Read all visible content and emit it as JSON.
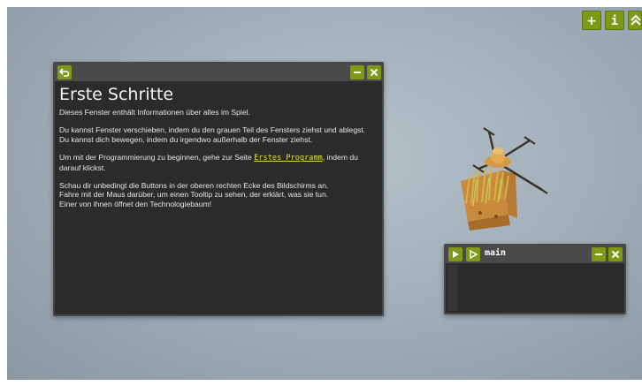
{
  "toolbar": {
    "add_label": "+",
    "info_label": "i",
    "collapse_label": "≫"
  },
  "info_window": {
    "title": "Erste Schritte",
    "intro": "Dieses Fenster enthält Informationen über alles im Spiel.",
    "move_text_1": "Du kannst Fenster verschieben, indem du den grauen Teil des Fensters ziehst und ablegst.",
    "move_text_2": "Du kannst dich bewegen, indem du irgendwo außerhalb der Fenster ziehst.",
    "program_text_before": "Um mit der Programmierung zu beginnen, gehe zur Seite ",
    "program_link": "Erstes Programm",
    "program_text_after": ", indem du darauf klickst.",
    "buttons_text_1": "Schau dir unbedingt die Buttons in der oberen rechten Ecke des Bildschirms an.",
    "buttons_text_2": "Fahre mit der Maus darüber, um einen Tooltip zu sehen, der erklärt, was sie tun.",
    "buttons_text_3": "Einer von ihnen öffnet den Technologiebaum!"
  },
  "code_window": {
    "name": "main"
  },
  "colors": {
    "accent": "#7d9a16",
    "panel_bg": "#2b2b2b",
    "titlebar": "#4a4a4a",
    "link": "#e0e04a"
  }
}
